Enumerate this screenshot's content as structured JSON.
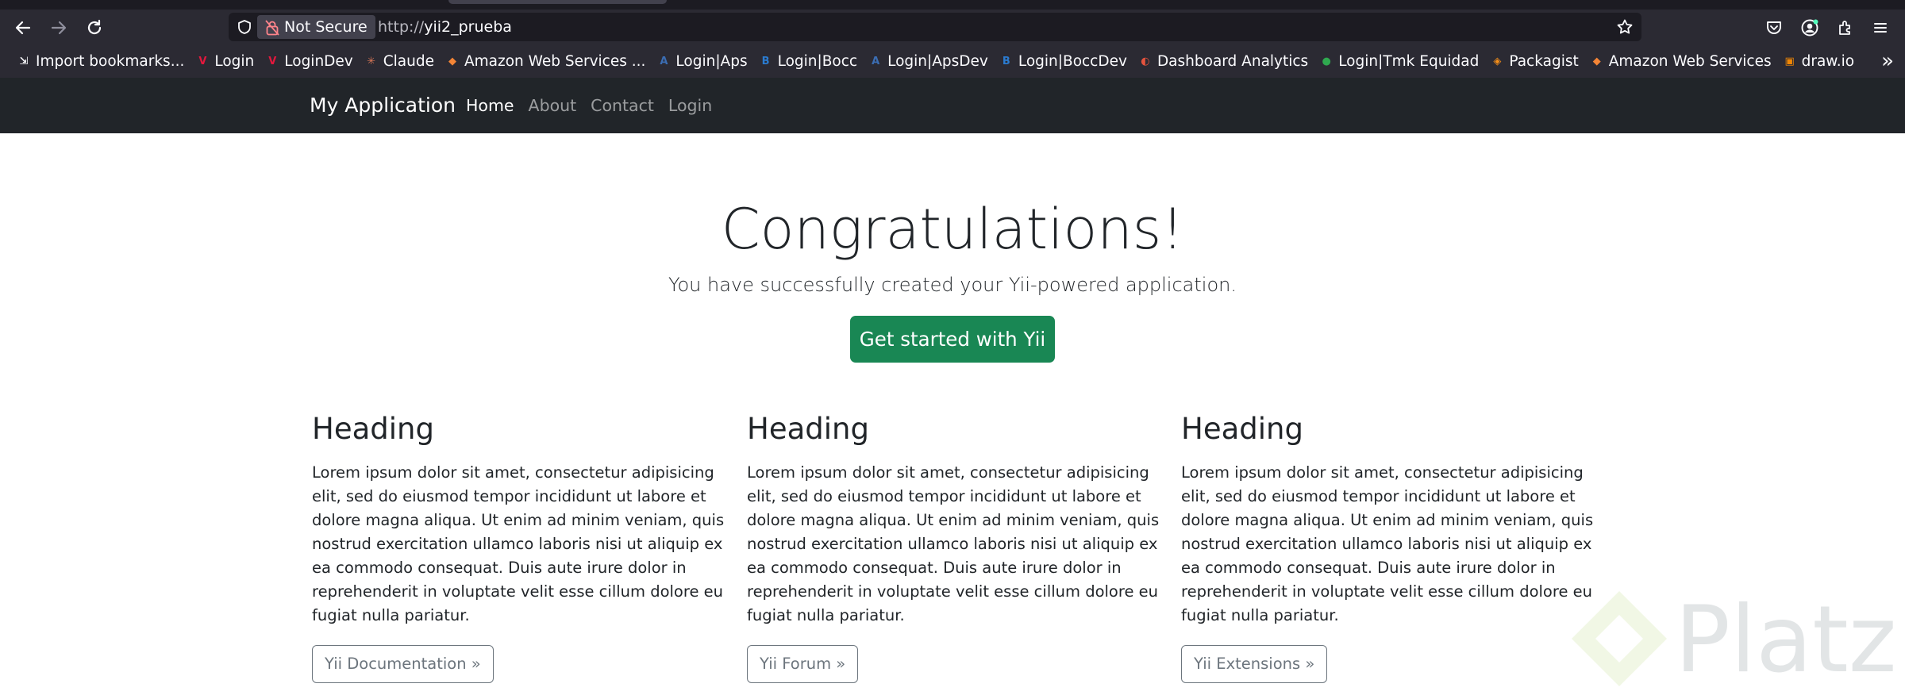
{
  "browser": {
    "url": {
      "scheme": "http://",
      "host": "yii2_prueba"
    },
    "security_label": "Not Secure",
    "icons": {
      "back": "back-arrow-icon",
      "forward": "forward-arrow-icon",
      "reload": "reload-icon",
      "shield": "tracking-protection-shield-icon",
      "lock": "insecure-lock-icon",
      "bookmark_star": "bookmark-star-icon",
      "pocket": "pocket-icon",
      "account": "account-icon",
      "extensions": "extensions-icon",
      "menu": "hamburger-menu-icon",
      "overflow": "chevron-double-right-icon"
    },
    "bookmarks": [
      {
        "label": "Import bookmarks...",
        "icon": "import-icon",
        "color": "#fbfbfe"
      },
      {
        "label": "Login",
        "icon": "v-logo-icon",
        "color": "#e2183d"
      },
      {
        "label": "LoginDev",
        "icon": "v-logo-icon",
        "color": "#e2183d"
      },
      {
        "label": "Claude",
        "icon": "claude-star-icon",
        "color": "#d97757"
      },
      {
        "label": "Amazon Web Services ...",
        "icon": "aws-cube-icon",
        "color": "#f58536"
      },
      {
        "label": "Login|Aps",
        "icon": "aps-icon",
        "color": "#3b6db3"
      },
      {
        "label": "Login|Bocc",
        "icon": "bocc-icon",
        "color": "#2b7bd0"
      },
      {
        "label": "Login|ApsDev",
        "icon": "aps-icon",
        "color": "#3b6db3"
      },
      {
        "label": "Login|BoccDev",
        "icon": "bocc-icon",
        "color": "#2b7bd0"
      },
      {
        "label": "Dashboard Analytics",
        "icon": "analytics-icon",
        "color": "#e5533d"
      },
      {
        "label": "Login|Tmk Equidad",
        "icon": "globe-icon",
        "color": "#2fa84f"
      },
      {
        "label": "Packagist",
        "icon": "packagist-icon",
        "color": "#f28d1a"
      },
      {
        "label": "Amazon Web Services",
        "icon": "aws-cube-icon",
        "color": "#f58536"
      },
      {
        "label": "draw.io",
        "icon": "drawio-icon",
        "color": "#f08705"
      }
    ]
  },
  "site": {
    "brand": "My Application",
    "nav": [
      {
        "label": "Home",
        "active": true
      },
      {
        "label": "About",
        "active": false
      },
      {
        "label": "Contact",
        "active": false
      },
      {
        "label": "Login",
        "active": false
      }
    ],
    "jumbotron": {
      "title": "Congratulations!",
      "lead": "You have successfully created your Yii-powered application.",
      "cta": "Get started with Yii"
    },
    "columns": [
      {
        "heading": "Heading",
        "text": "Lorem ipsum dolor sit amet, consectetur adipisicing elit, sed do eiusmod tempor incididunt ut labore et dolore magna aliqua. Ut enim ad minim veniam, quis nostrud exercitation ullamco laboris nisi ut aliquip ex ea commodo consequat. Duis aute irure dolor in reprehenderit in voluptate velit esse cillum dolore eu fugiat nulla pariatur.",
        "button": "Yii Documentation »"
      },
      {
        "heading": "Heading",
        "text": "Lorem ipsum dolor sit amet, consectetur adipisicing elit, sed do eiusmod tempor incididunt ut labore et dolore magna aliqua. Ut enim ad minim veniam, quis nostrud exercitation ullamco laboris nisi ut aliquip ex ea commodo consequat. Duis aute irure dolor in reprehenderit in voluptate velit esse cillum dolore eu fugiat nulla pariatur.",
        "button": "Yii Forum »"
      },
      {
        "heading": "Heading",
        "text": "Lorem ipsum dolor sit amet, consectetur adipisicing elit, sed do eiusmod tempor incididunt ut labore et dolore magna aliqua. Ut enim ad minim veniam, quis nostrud exercitation ullamco laboris nisi ut aliquip ex ea commodo consequat. Duis aute irure dolor in reprehenderit in voluptate velit esse cillum dolore eu fugiat nulla pariatur.",
        "button": "Yii Extensions »"
      }
    ],
    "colors": {
      "navbar_bg": "#212529",
      "cta_bg": "#198754",
      "outline_btn": "#6c757d"
    }
  },
  "watermark": {
    "text": "Platzi"
  }
}
